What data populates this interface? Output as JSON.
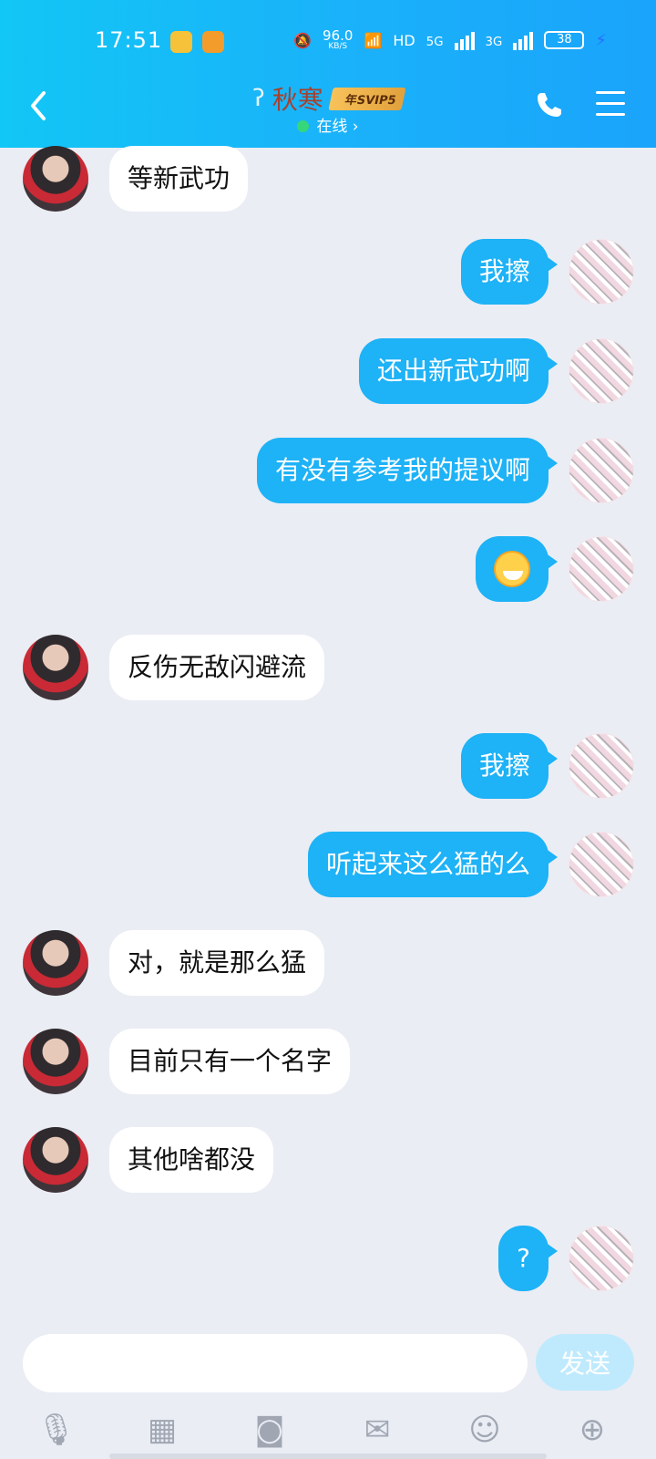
{
  "status": {
    "time": "17:51",
    "speed": "96.0",
    "speed_unit": "KB/S",
    "hd": "HD",
    "net1": "5G",
    "net2": "3G",
    "battery": "38"
  },
  "header": {
    "contact_name": "秋寒",
    "vip_badge": "年SVIP5",
    "status": "在线",
    "status_chevron": "›",
    "back_icon": "chevron-left-icon",
    "call_icon": "phone-icon",
    "menu_icon": "menu-icon"
  },
  "messages": [
    {
      "from": "peer",
      "text": "等新武功"
    },
    {
      "from": "me",
      "text": "我擦"
    },
    {
      "from": "me",
      "text": "还出新武功啊"
    },
    {
      "from": "me",
      "text": "有没有参考我的提议啊"
    },
    {
      "from": "me",
      "text": "",
      "emoji": "grin-emoji"
    },
    {
      "from": "peer",
      "text": "反伤无敌闪避流"
    },
    {
      "from": "me",
      "text": "我擦"
    },
    {
      "from": "me",
      "text": "听起来这么猛的么"
    },
    {
      "from": "peer",
      "text": "对，就是那么猛"
    },
    {
      "from": "peer",
      "text": "目前只有一个名字"
    },
    {
      "from": "peer",
      "text": "其他啥都没"
    },
    {
      "from": "me",
      "text": "?"
    }
  ],
  "composer": {
    "input_value": "",
    "send_label": "发送",
    "tools": [
      "microphone-icon",
      "image-icon",
      "camera-icon",
      "red-packet-icon",
      "emoji-icon",
      "plus-icon"
    ]
  },
  "colors": {
    "header_gradient_start": "#12c6f5",
    "header_gradient_end": "#1aa4fb",
    "outgoing_bubble": "#1eb2f6",
    "incoming_bubble": "#ffffff",
    "chat_background": "#eaedf4",
    "send_button_disabled": "#bfeafd"
  }
}
